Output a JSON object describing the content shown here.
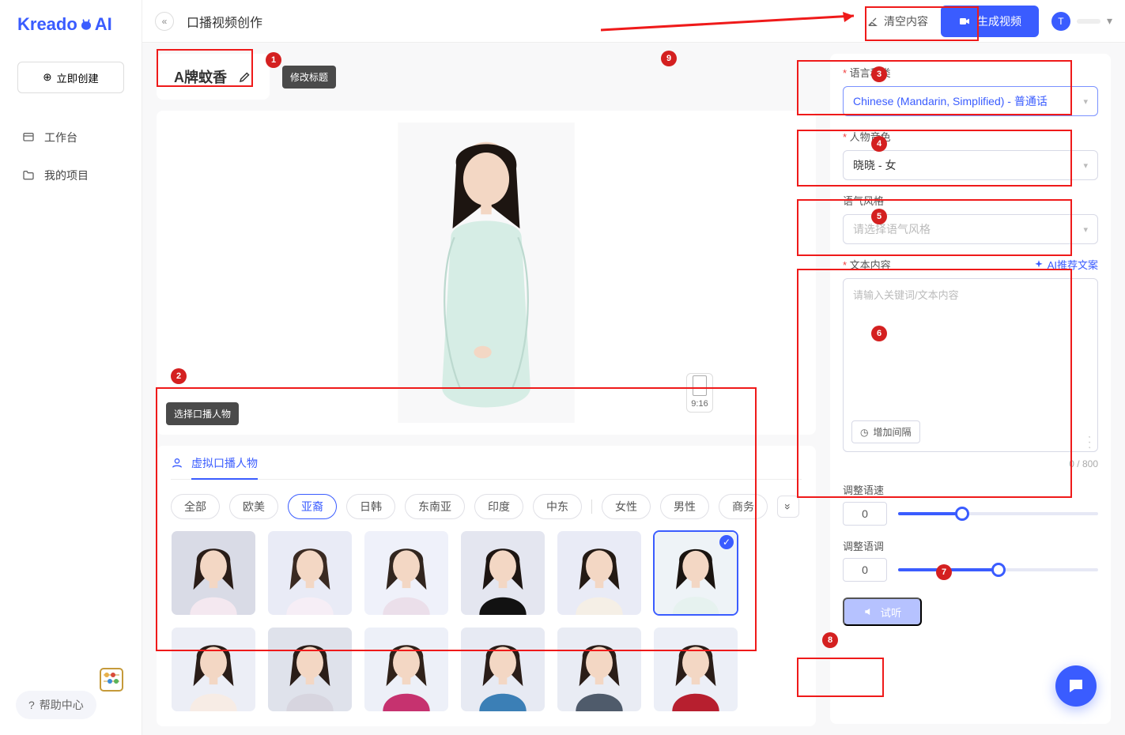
{
  "brand": {
    "name": "Kreado",
    "suffix": "AI"
  },
  "sidebar": {
    "create": "立即创建",
    "items": [
      {
        "icon": "dashboard",
        "label": "工作台"
      },
      {
        "icon": "folder",
        "label": "我的项目"
      }
    ],
    "help": "帮助中心"
  },
  "topbar": {
    "title": "口播视频创作",
    "clear": "清空内容",
    "generate": "生成视频",
    "user_initial": "T"
  },
  "canvas": {
    "doc_title": "A牌蚊香",
    "tooltip_title": "修改标题",
    "tooltip_select": "选择口播人物",
    "ratio": "9:16",
    "gallery_tab": "虚拟口播人物",
    "region_chips": [
      "全部",
      "欧美",
      "亚裔",
      "日韩",
      "东南亚",
      "印度",
      "中东"
    ],
    "region_selected_index": 2,
    "gender_chips": [
      "女性",
      "男性",
      "商务"
    ],
    "avatars": [
      {
        "bg": "#d9dbe6",
        "hair": "#2a1d18",
        "top": "#f4e8f0"
      },
      {
        "bg": "#e9ebf6",
        "hair": "#3a2a22",
        "top": "#f6eef6"
      },
      {
        "bg": "#eff1fa",
        "hair": "#32261f",
        "top": "#ebdfea"
      },
      {
        "bg": "#e4e6f0",
        "hair": "#1d1512",
        "top": "#121212"
      },
      {
        "bg": "#e9ebf6",
        "hair": "#241a14",
        "top": "#f5efe6"
      },
      {
        "bg": "#eef3f7",
        "hair": "#1a1410",
        "top": "#e6f2ef"
      },
      {
        "bg": "#eceef6",
        "hair": "#2a1d18",
        "top": "#f7ece5"
      },
      {
        "bg": "#dfe2eb",
        "hair": "#2a1d18",
        "top": "#d7d5df"
      },
      {
        "bg": "#edf0f8",
        "hair": "#30221a",
        "top": "#c6326f"
      },
      {
        "bg": "#e7eaf3",
        "hair": "#2a1d18",
        "top": "#3b7fb6"
      },
      {
        "bg": "#e9ecf4",
        "hair": "#2a1d18",
        "top": "#4f5b6b"
      },
      {
        "bg": "#eceff7",
        "hair": "#2a1d18",
        "top": "#b71f2f"
      }
    ],
    "selected_avatar_index": 5
  },
  "panel": {
    "lang_label": "语言种类",
    "lang_value": "Chinese (Mandarin, Simplified) - 普通话",
    "voice_label": "人物音色",
    "voice_value": "晓晓 - 女",
    "tone_label": "语气风格",
    "tone_placeholder": "请选择语气风格",
    "text_label": "文本内容",
    "ai_suggest": "AI推荐文案",
    "text_placeholder": "请输入关键词/文本内容",
    "add_gap": "增加间隔",
    "counter": "0 / 800",
    "speed_label": "调整语速",
    "speed_value": "0",
    "pitch_label": "调整语调",
    "pitch_value": "0",
    "play": "试听"
  },
  "annotations": {
    "nums": [
      "1",
      "2",
      "3",
      "4",
      "5",
      "6",
      "7",
      "8",
      "9"
    ]
  }
}
